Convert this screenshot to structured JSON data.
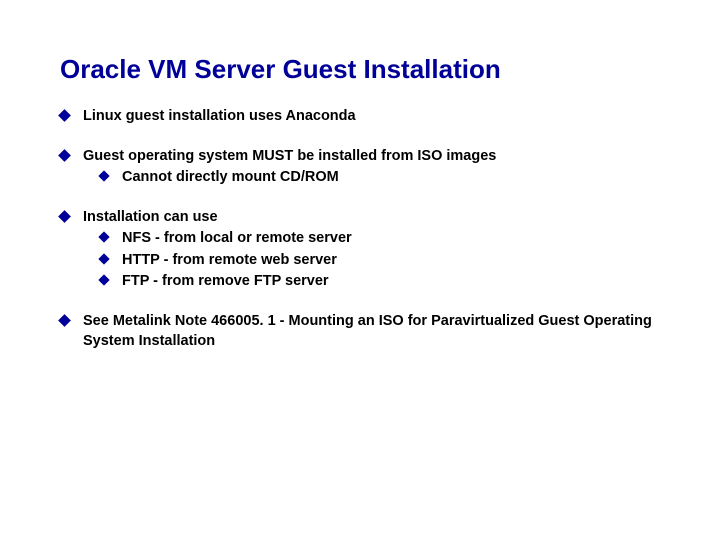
{
  "title": "Oracle VM Server Guest Installation",
  "b1": "Linux guest installation uses Anaconda",
  "b2": "Guest operating system MUST be installed from ISO images",
  "b2a": "Cannot directly mount CD/ROM",
  "b3": "Installation can use",
  "b3a": "NFS - from local or remote server",
  "b3b": "HTTP - from remote web server",
  "b3c": "FTP - from remove FTP server",
  "b4": "See Metalink Note 466005. 1 - Mounting an ISO for Paravirtualized Guest Operating System Installation"
}
